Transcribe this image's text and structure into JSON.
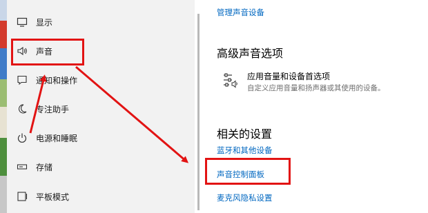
{
  "colors": {
    "link": "#0067c0",
    "annotation": "#e21313",
    "nav_bg": "#f2f2f2"
  },
  "nav": {
    "items": [
      {
        "label": "显示",
        "icon": "monitor-icon"
      },
      {
        "label": "声音",
        "icon": "speaker-icon"
      },
      {
        "label": "通知和操作",
        "icon": "notification-icon"
      },
      {
        "label": "专注助手",
        "icon": "moon-icon"
      },
      {
        "label": "电源和睡眠",
        "icon": "power-icon"
      },
      {
        "label": "存储",
        "icon": "storage-icon"
      },
      {
        "label": "平板模式",
        "icon": "tablet-icon"
      }
    ]
  },
  "content": {
    "manage_devices_link": "管理声音设备",
    "advanced_heading": "高级声音选项",
    "app_volume": {
      "title": "应用音量和设备首选项",
      "description": "自定义应用音量和扬声器或其使用的设备。",
      "icon": "sliders-speaker-icon"
    },
    "related_heading": "相关的设置",
    "related_links": [
      "蓝牙和其他设备",
      "声音控制面板",
      "麦克风隐私设置"
    ]
  }
}
